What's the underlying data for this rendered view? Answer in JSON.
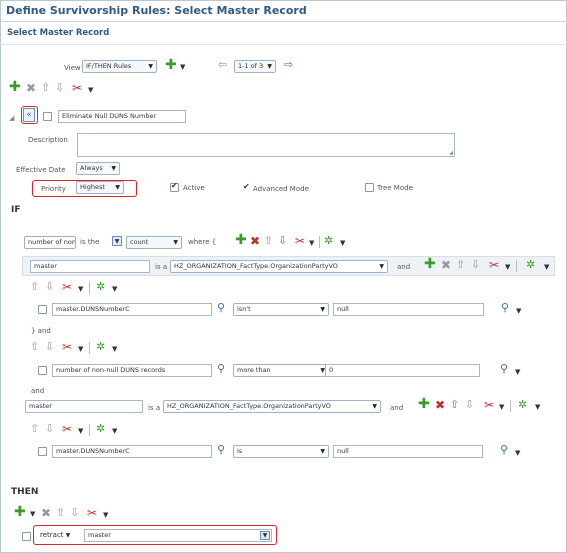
{
  "header": {
    "title": "Define Survivorship Rules: Select Master Record",
    "subtitle": "Select Master Record"
  },
  "toolbar": {
    "view_label": "View",
    "view_value": "IF/THEN Rules",
    "pager_value": "1-1 of 3"
  },
  "rule": {
    "name": "Eliminate Null DUNS Number",
    "description_label": "Description",
    "effective_date_label": "Effective Date",
    "effective_date_value": "Always",
    "priority_label": "Priority",
    "priority_value": "Highest",
    "active_label": "Active",
    "advanced_mode_label": "Advanced Mode",
    "tree_mode_label": "Tree Mode"
  },
  "if_section": {
    "label": "IF",
    "aggregate": {
      "field": "number of non-",
      "is_the": "is the",
      "func": "count",
      "where": "where {"
    },
    "first_var": {
      "name": "master",
      "is_a": "is a",
      "type": "HZ_ORGANIZATION_FactType.OrganizationPartyVO",
      "and": "and"
    },
    "first_condition": {
      "field": "master.DUNSNumberC",
      "operator": "isn't",
      "value": "null"
    },
    "close_and": "} and",
    "second_condition": {
      "field": "number of non-null DUNS records",
      "operator": "more than",
      "value": "0"
    },
    "and_label": "and",
    "second_var": {
      "name": "master",
      "is_a": "is a",
      "type": "HZ_ORGANIZATION_FactType.OrganizationPartyVO",
      "and": "and"
    },
    "third_condition": {
      "field": "master.DUNSNumberC",
      "operator": "is",
      "value": "null"
    }
  },
  "then_section": {
    "label": "THEN",
    "action": "retract",
    "target": "master"
  },
  "icons": {
    "caret": "▼",
    "plus": "✚",
    "x": "✖",
    "up": "⇧",
    "down": "⇩",
    "scissors": "✂",
    "gear": "✲",
    "search": "⚲",
    "left": "⇦",
    "right": "⇨",
    "check": "✔",
    "collapse": "«"
  }
}
